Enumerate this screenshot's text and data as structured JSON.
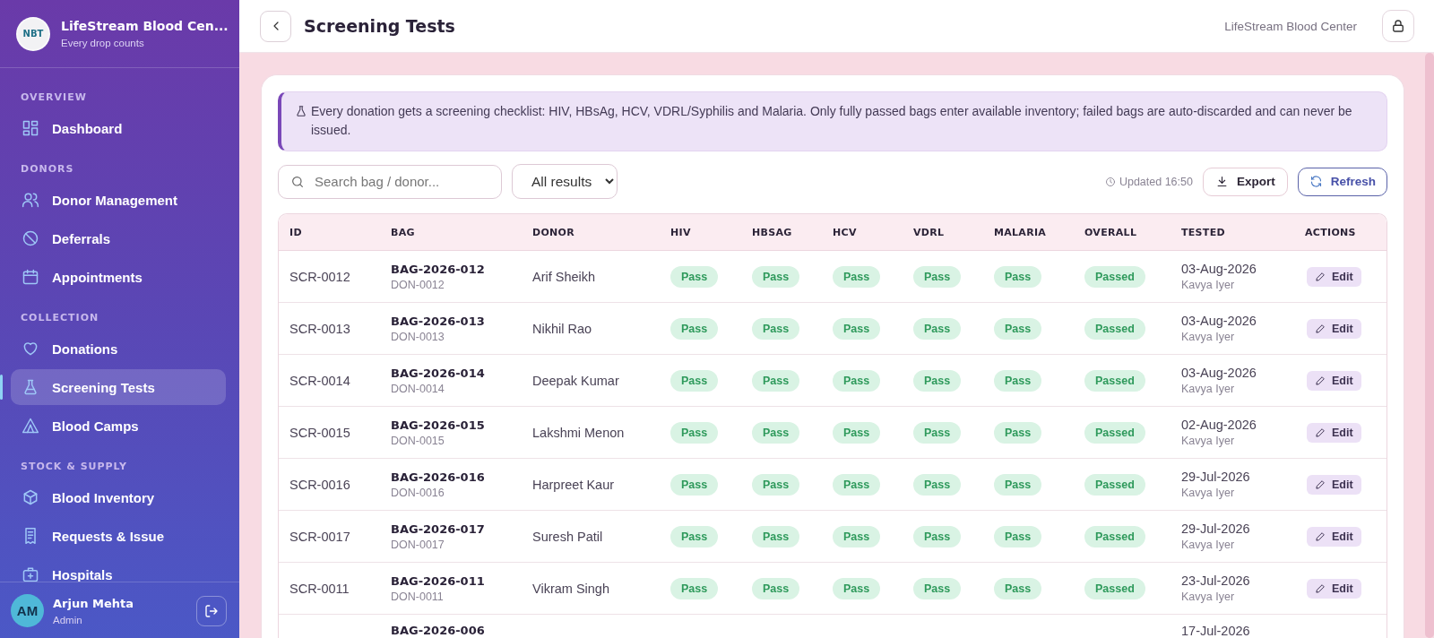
{
  "sidebar": {
    "brand": {
      "logo_text": "NBT",
      "name": "LifeStream Blood Cen...",
      "tagline": "Every drop counts"
    },
    "sections": [
      {
        "title": "OVERVIEW",
        "items": [
          {
            "label": "Dashboard",
            "selected": false
          }
        ]
      },
      {
        "title": "DONORS",
        "items": [
          {
            "label": "Donor Management",
            "selected": false
          },
          {
            "label": "Deferrals",
            "selected": false
          },
          {
            "label": "Appointments",
            "selected": false
          }
        ]
      },
      {
        "title": "COLLECTION",
        "items": [
          {
            "label": "Donations",
            "selected": false
          },
          {
            "label": "Screening Tests",
            "selected": true
          },
          {
            "label": "Blood Camps",
            "selected": false
          }
        ]
      },
      {
        "title": "STOCK & SUPPLY",
        "items": [
          {
            "label": "Blood Inventory",
            "selected": false
          },
          {
            "label": "Requests & Issue",
            "selected": false
          },
          {
            "label": "Hospitals",
            "selected": false
          }
        ]
      }
    ],
    "user": {
      "initials": "AM",
      "name": "Arjun Mehta",
      "role": "Admin"
    }
  },
  "header": {
    "title": "Screening Tests",
    "center_name": "LifeStream Blood Center"
  },
  "notice": "Every donation gets a screening checklist: HIV, HBsAg, HCV, VDRL/Syphilis and Malaria. Only fully passed bags enter available inventory; failed bags are auto-discarded and can never be issued.",
  "toolbar": {
    "search": {
      "placeholder": "Search bag / donor..."
    },
    "filter": {
      "value": "All results"
    },
    "updated": "Updated 16:50",
    "buttons": [
      {
        "label": "Export",
        "kind": "export"
      },
      {
        "label": "Refresh",
        "kind": "refresh"
      }
    ]
  },
  "table": {
    "columns": [
      "ID",
      "BAG",
      "DONOR",
      "HIV",
      "HBSAG",
      "HCV",
      "VDRL",
      "MALARIA",
      "OVERALL",
      "TESTED",
      "ACTIONS"
    ],
    "rows": [
      {
        "id": "SCR-0012",
        "bag": "BAG-2026-012",
        "donor_id": "DON-0012",
        "donor": "Arif Sheikh",
        "tests": [
          {
            "label": "Pass",
            "passed": true
          },
          {
            "label": "Pass",
            "passed": true
          },
          {
            "label": "Pass",
            "passed": true
          },
          {
            "label": "Pass",
            "passed": true
          },
          {
            "label": "Pass",
            "passed": true
          }
        ],
        "overall": {
          "label": "Passed",
          "passed": true
        },
        "tested": "03-Aug-2026",
        "tested_by": "Kavya Iyer",
        "action": "Edit"
      },
      {
        "id": "SCR-0013",
        "bag": "BAG-2026-013",
        "donor_id": "DON-0013",
        "donor": "Nikhil Rao",
        "tests": [
          {
            "label": "Pass",
            "passed": true
          },
          {
            "label": "Pass",
            "passed": true
          },
          {
            "label": "Pass",
            "passed": true
          },
          {
            "label": "Pass",
            "passed": true
          },
          {
            "label": "Pass",
            "passed": true
          }
        ],
        "overall": {
          "label": "Passed",
          "passed": true
        },
        "tested": "03-Aug-2026",
        "tested_by": "Kavya Iyer",
        "action": "Edit"
      },
      {
        "id": "SCR-0014",
        "bag": "BAG-2026-014",
        "donor_id": "DON-0014",
        "donor": "Deepak Kumar",
        "tests": [
          {
            "label": "Pass",
            "passed": true
          },
          {
            "label": "Pass",
            "passed": true
          },
          {
            "label": "Pass",
            "passed": true
          },
          {
            "label": "Pass",
            "passed": true
          },
          {
            "label": "Pass",
            "passed": true
          }
        ],
        "overall": {
          "label": "Passed",
          "passed": true
        },
        "tested": "03-Aug-2026",
        "tested_by": "Kavya Iyer",
        "action": "Edit"
      },
      {
        "id": "SCR-0015",
        "bag": "BAG-2026-015",
        "donor_id": "DON-0015",
        "donor": "Lakshmi Menon",
        "tests": [
          {
            "label": "Pass",
            "passed": true
          },
          {
            "label": "Pass",
            "passed": true
          },
          {
            "label": "Pass",
            "passed": true
          },
          {
            "label": "Pass",
            "passed": true
          },
          {
            "label": "Pass",
            "passed": true
          }
        ],
        "overall": {
          "label": "Passed",
          "passed": true
        },
        "tested": "02-Aug-2026",
        "tested_by": "Kavya Iyer",
        "action": "Edit"
      },
      {
        "id": "SCR-0016",
        "bag": "BAG-2026-016",
        "donor_id": "DON-0016",
        "donor": "Harpreet Kaur",
        "tests": [
          {
            "label": "Pass",
            "passed": true
          },
          {
            "label": "Pass",
            "passed": true
          },
          {
            "label": "Pass",
            "passed": true
          },
          {
            "label": "Pass",
            "passed": true
          },
          {
            "label": "Pass",
            "passed": true
          }
        ],
        "overall": {
          "label": "Passed",
          "passed": true
        },
        "tested": "29-Jul-2026",
        "tested_by": "Kavya Iyer",
        "action": "Edit"
      },
      {
        "id": "SCR-0017",
        "bag": "BAG-2026-017",
        "donor_id": "DON-0017",
        "donor": "Suresh Patil",
        "tests": [
          {
            "label": "Pass",
            "passed": true
          },
          {
            "label": "Pass",
            "passed": true
          },
          {
            "label": "Pass",
            "passed": true
          },
          {
            "label": "Pass",
            "passed": true
          },
          {
            "label": "Pass",
            "passed": true
          }
        ],
        "overall": {
          "label": "Passed",
          "passed": true
        },
        "tested": "29-Jul-2026",
        "tested_by": "Kavya Iyer",
        "action": "Edit"
      },
      {
        "id": "SCR-0011",
        "bag": "BAG-2026-011",
        "donor_id": "DON-0011",
        "donor": "Vikram Singh",
        "tests": [
          {
            "label": "Pass",
            "passed": true
          },
          {
            "label": "Pass",
            "passed": true
          },
          {
            "label": "Pass",
            "passed": true
          },
          {
            "label": "Pass",
            "passed": true
          },
          {
            "label": "Pass",
            "passed": true
          }
        ],
        "overall": {
          "label": "Passed",
          "passed": true
        },
        "tested": "23-Jul-2026",
        "tested_by": "Kavya Iyer",
        "action": "Edit"
      },
      {
        "bag": "BAG-2026-006",
        "tested": "17-Jul-2026"
      }
    ]
  }
}
